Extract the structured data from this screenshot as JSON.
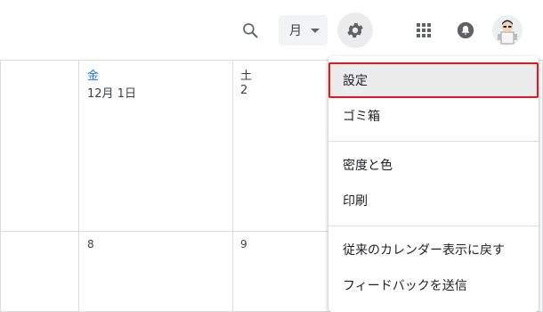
{
  "toolbar": {
    "view_select_value": "月",
    "icons": {
      "search": "search-icon",
      "settings": "gear-icon",
      "apps": "apps-grid-icon",
      "notifications": "bell-icon",
      "avatar": "user-avatar"
    }
  },
  "calendar": {
    "columns": [
      {
        "dow": "金",
        "date": "12月 1日",
        "dow_color": "#1a73e8"
      },
      {
        "dow": "土",
        "date": "2",
        "dow_color": "#3c4043"
      }
    ],
    "week2": [
      "8",
      "9"
    ]
  },
  "settings_menu": {
    "items": [
      {
        "label": "設定",
        "highlighted": true
      },
      {
        "label": "ゴミ箱"
      },
      {
        "label": "密度と色"
      },
      {
        "label": "印刷"
      },
      {
        "label": "従来のカレンダー表示に戻す"
      },
      {
        "label": "フィードバックを送信"
      }
    ],
    "highlight_color": "#e1191c"
  }
}
